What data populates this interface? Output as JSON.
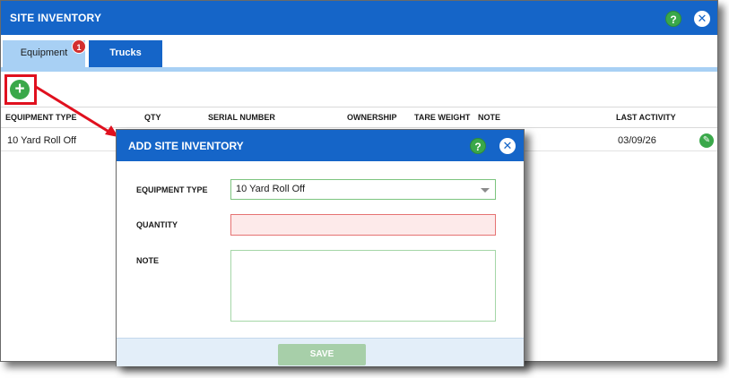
{
  "main_window": {
    "title": "SITE INVENTORY",
    "help_icon": "?",
    "close_icon": "✕"
  },
  "tabs": [
    {
      "label": "Equipment",
      "badge": "1",
      "active": true
    },
    {
      "label": "Trucks",
      "active": false
    }
  ],
  "toolbar": {
    "add_icon": "+"
  },
  "table": {
    "columns": [
      "EQUIPMENT TYPE",
      "QTY",
      "SERIAL NUMBER",
      "OWNERSHIP",
      "TARE WEIGHT",
      "NOTE",
      "LAST ACTIVITY"
    ],
    "rows": [
      {
        "equipment_type": "10 Yard Roll Off",
        "last_activity": "03/09/26",
        "action_icon": "✎"
      }
    ]
  },
  "dialog": {
    "title": "ADD SITE INVENTORY",
    "help_icon": "?",
    "close_icon": "✕",
    "fields": {
      "equipment_type_label": "EQUIPMENT TYPE",
      "equipment_type_value": "10 Yard Roll Off",
      "quantity_label": "QUANTITY",
      "quantity_value": "",
      "note_label": "NOTE",
      "note_value": ""
    },
    "save_label": "SAVE"
  },
  "colors": {
    "titlebar": "#1565c8",
    "active_tab": "#a8d0f4",
    "accent_green": "#3aa84a",
    "highlight_red": "#e0101e",
    "invalid_field_bg": "#fdeaea"
  }
}
